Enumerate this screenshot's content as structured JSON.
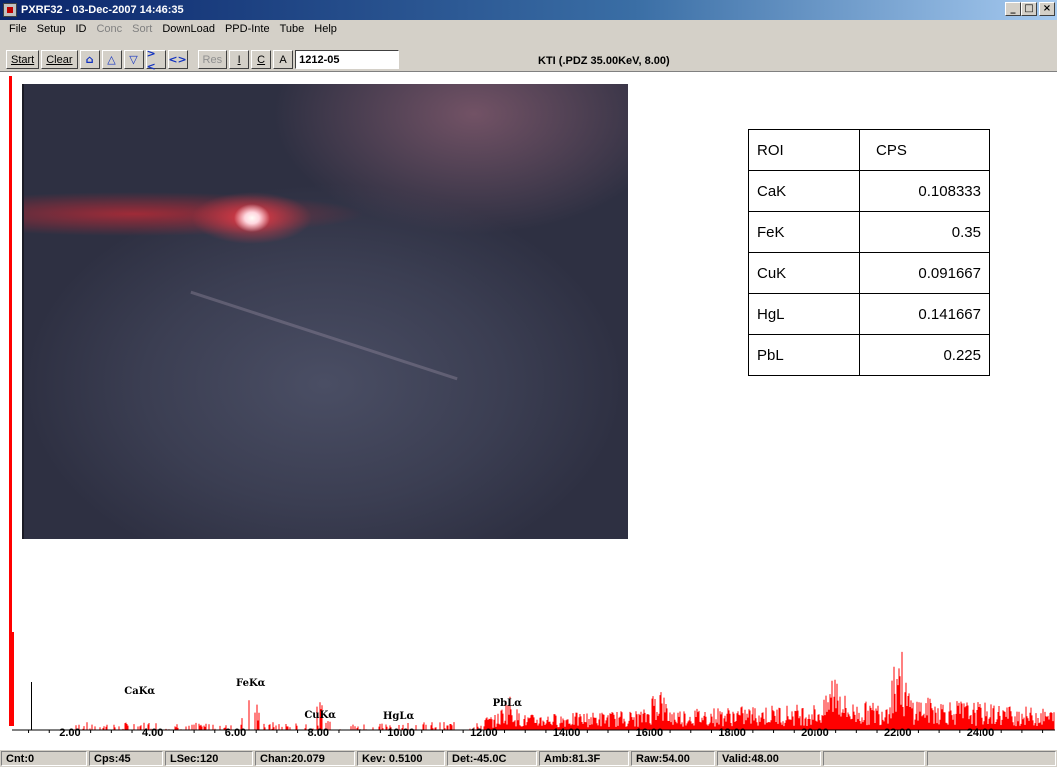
{
  "window": {
    "title": "PXRF32 - 03-Dec-2007 14:46:35",
    "minimize": "_",
    "maximize": "□",
    "close": "×"
  },
  "menu": [
    "File",
    "Setup",
    "ID",
    "Conc",
    "Sort",
    "DownLoad",
    "PPD-Inte",
    "Tube",
    "Help"
  ],
  "menu_disabled": [
    "Conc",
    "Sort"
  ],
  "toolbar": {
    "start": "Start",
    "clear": "Clear",
    "res": "Res",
    "i": "I",
    "c": "C",
    "a": "A",
    "sample_id": "1212-05",
    "status": "KTI  (.PDZ 35.00KeV, 8.00)"
  },
  "roi_table": {
    "headers": [
      "ROI",
      "CPS"
    ],
    "rows": [
      {
        "roi": "CaK",
        "cps": "0.108333"
      },
      {
        "roi": "FeK",
        "cps": "0.35"
      },
      {
        "roi": "CuK",
        "cps": "0.091667"
      },
      {
        "roi": "HgL",
        "cps": "0.141667"
      },
      {
        "roi": "PbL",
        "cps": "0.225"
      }
    ]
  },
  "chart_data": {
    "type": "bar",
    "xlabel": "",
    "ylabel": "",
    "xlim": [
      0.6,
      25.8
    ],
    "x_ticks": [
      "2.00",
      "4.00",
      "6.00",
      "8.00",
      "10.00",
      "12.00",
      "14.00",
      "16.00",
      "18.00",
      "20.00",
      "22.00",
      "24.00"
    ],
    "annotations": [
      {
        "label": "CaKα",
        "x": 3.7
      },
      {
        "label": "FeKα",
        "x": 6.4
      },
      {
        "label": "CuKα",
        "x": 8.05
      },
      {
        "label": "HgLα",
        "x": 9.95
      },
      {
        "label": "PbLα",
        "x": 12.6
      }
    ],
    "color": "#ff0000"
  },
  "status_bar": [
    "Cnt:0",
    "Cps:45",
    "LSec:120",
    "Chan:20.079",
    "Kev: 0.5100",
    "Det:-45.0C",
    "Amb:81.3F",
    "Raw:54.00",
    "Valid:48.00",
    "",
    ""
  ]
}
